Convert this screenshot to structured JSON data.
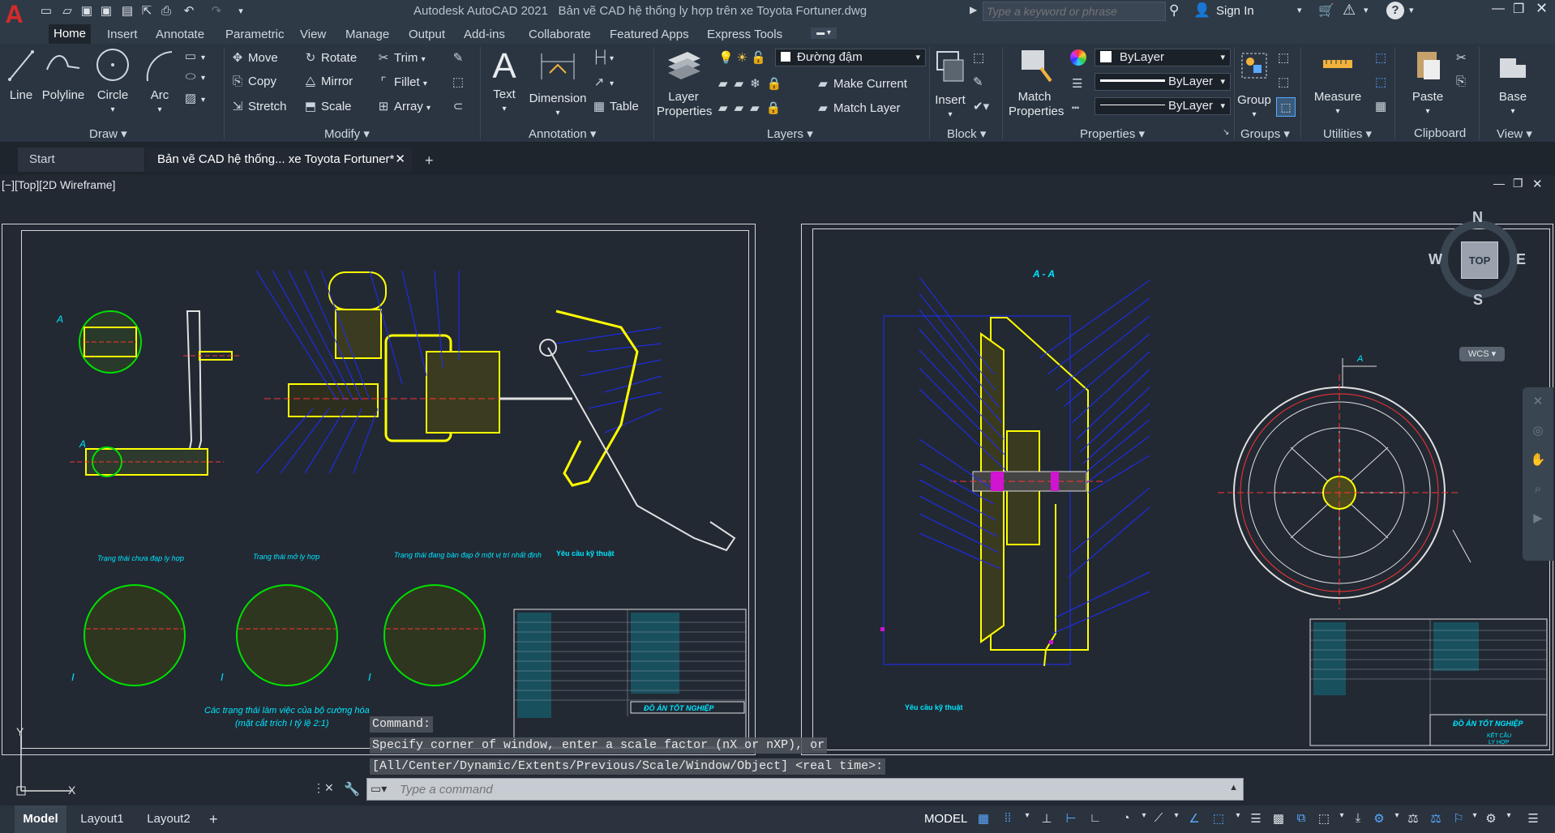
{
  "app": {
    "title": "Autodesk AutoCAD 2021",
    "filename": "Bản vẽ CAD hệ thống ly hợp trên xe Toyota Fortuner.dwg",
    "search_placeholder": "Type a keyword or phrase",
    "sign_in": "Sign In"
  },
  "ribbon_tabs": [
    "Home",
    "Insert",
    "Annotate",
    "Parametric",
    "View",
    "Manage",
    "Output",
    "Add-ins",
    "Collaborate",
    "Featured Apps",
    "Express Tools"
  ],
  "draw": {
    "title": "Draw",
    "line": "Line",
    "polyline": "Polyline",
    "circle": "Circle",
    "arc": "Arc"
  },
  "modify": {
    "title": "Modify",
    "move": "Move",
    "rotate": "Rotate",
    "trim": "Trim",
    "copy": "Copy",
    "mirror": "Mirror",
    "fillet": "Fillet",
    "stretch": "Stretch",
    "scale": "Scale",
    "array": "Array"
  },
  "annotation": {
    "title": "Annotation",
    "text": "Text",
    "dimension": "Dimension",
    "table": "Table"
  },
  "layers": {
    "title": "Layers",
    "layer_properties_1": "Layer",
    "layer_properties_2": "Properties",
    "current_layer": "Đường đậm",
    "make_current": "Make Current",
    "match_layer": "Match Layer"
  },
  "block": {
    "title": "Block",
    "insert": "Insert"
  },
  "properties": {
    "title": "Properties",
    "match_1": "Match",
    "match_2": "Properties",
    "color": "ByLayer",
    "linetype": "ByLayer",
    "lineweight": "ByLayer"
  },
  "groups": {
    "title": "Groups",
    "group": "Group"
  },
  "utilities": {
    "title": "Utilities",
    "measure": "Measure"
  },
  "clipboard": {
    "title": "Clipboard",
    "paste": "Paste"
  },
  "view": {
    "title": "View",
    "base": "Base"
  },
  "doc_tabs": {
    "start": "Start",
    "active": "Bản vẽ CAD hệ thống... xe Toyota Fortuner*"
  },
  "viewport": {
    "label": "[−][Top][2D Wireframe]",
    "compass": {
      "n": "N",
      "s": "S",
      "e": "E",
      "w": "W",
      "top": "TOP",
      "wcs": "WCS"
    }
  },
  "drawing_text": {
    "section_aa": "A - A",
    "req_left_title": "Yêu cầu kỹ thuật",
    "req_right_title": "Yêu cầu kỹ thuật",
    "state1": "Trạng thái chưa đạp ly hợp",
    "state2": "Trạng thái mở ly hợp",
    "state3": "Trạng thái đang bàn đạp ở một vị trí nhất định",
    "caption1": "Các trạng thái làm việc của bộ cường hóa",
    "caption2": "(mặt cắt trích I tỷ lệ 2:1)",
    "do_an_left": "ĐỒ ÁN TỐT NGHIỆP",
    "do_an_right": "ĐỒ ÁN TỐT NGHIỆP",
    "ket_cau": "KẾT CẤU",
    "ly_hop": "LY HỢP",
    "label_a": "A",
    "label_i": "I"
  },
  "command": {
    "line1": "Command:",
    "line2": "Specify corner of window, enter a scale factor (nX or nXP), or",
    "line3": "[All/Center/Dynamic/Extents/Previous/Scale/Window/Object] <real time>:",
    "placeholder": "Type a command"
  },
  "layout_tabs": [
    "Model",
    "Layout1",
    "Layout2"
  ],
  "status": {
    "model": "MODEL"
  },
  "colors": {
    "accent_red": "#c9252c",
    "title_bg": "#2f3a47",
    "ribbon_bg": "#2b3542",
    "canvas_bg": "#222933",
    "drawing_yellow": "#ffff00",
    "drawing_cyan": "#00e5ff",
    "drawing_blue": "#1e2cff"
  }
}
